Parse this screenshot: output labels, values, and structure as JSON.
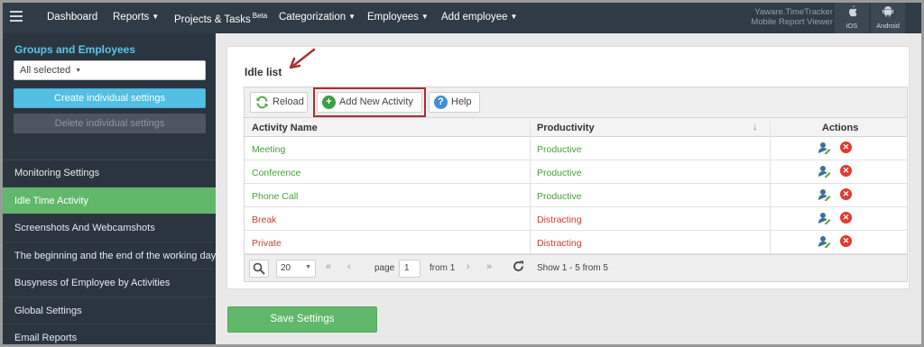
{
  "nav": {
    "items": [
      {
        "label": "Dashboard",
        "caret": false
      },
      {
        "label": "Reports",
        "caret": true
      },
      {
        "label": "Projects & Tasks",
        "sup": "Beta",
        "caret": false
      },
      {
        "label": "Categorization",
        "caret": true
      },
      {
        "label": "Employees",
        "caret": true
      },
      {
        "label": "Add employee",
        "caret": true
      }
    ],
    "brand_line1": "Yaware.TimeTracker",
    "brand_line2": "Mobile Report Viewer",
    "ios_label": "iOS",
    "android_label": "Android"
  },
  "sidebar": {
    "title": "Groups and Employees",
    "select_value": "All selected",
    "create_button": "Create individual settings",
    "delete_button": "Delete individual settings",
    "menu": [
      {
        "label": "Monitoring Settings",
        "active": false
      },
      {
        "label": "Idle Time Activity",
        "active": true
      },
      {
        "label": "Screenshots And Webcamshots",
        "active": false
      },
      {
        "label": "The beginning and the end of the working day",
        "active": false
      },
      {
        "label": "Busyness of Employee by Activities",
        "active": false
      },
      {
        "label": "Global Settings",
        "active": false
      },
      {
        "label": "Email Reports",
        "active": false
      }
    ]
  },
  "panel": {
    "title": "Idle list",
    "toolbar": {
      "reload": "Reload",
      "add": "Add New Activity",
      "help": "Help"
    },
    "columns": {
      "name": "Activity Name",
      "productivity": "Productivity",
      "actions": "Actions"
    },
    "rows": [
      {
        "name": "Meeting",
        "productivity": "Productive",
        "status": "green"
      },
      {
        "name": "Conference",
        "productivity": "Productive",
        "status": "green"
      },
      {
        "name": "Phone Call",
        "productivity": "Productive",
        "status": "green"
      },
      {
        "name": "Break",
        "productivity": "Distracting",
        "status": "red"
      },
      {
        "name": "Private",
        "productivity": "Distracting",
        "status": "red"
      }
    ],
    "pager": {
      "page_size": "20",
      "page_label": "page",
      "page_value": "1",
      "from_label": "from 1",
      "summary": "Show 1 - 5 from 5"
    }
  },
  "save_button": "Save Settings",
  "colors": {
    "accent_green": "#61b86a",
    "accent_blue": "#52bfe3",
    "highlight_red": "#b22a31",
    "productive": "#4b9e3a",
    "distracting": "#cc3d34"
  }
}
